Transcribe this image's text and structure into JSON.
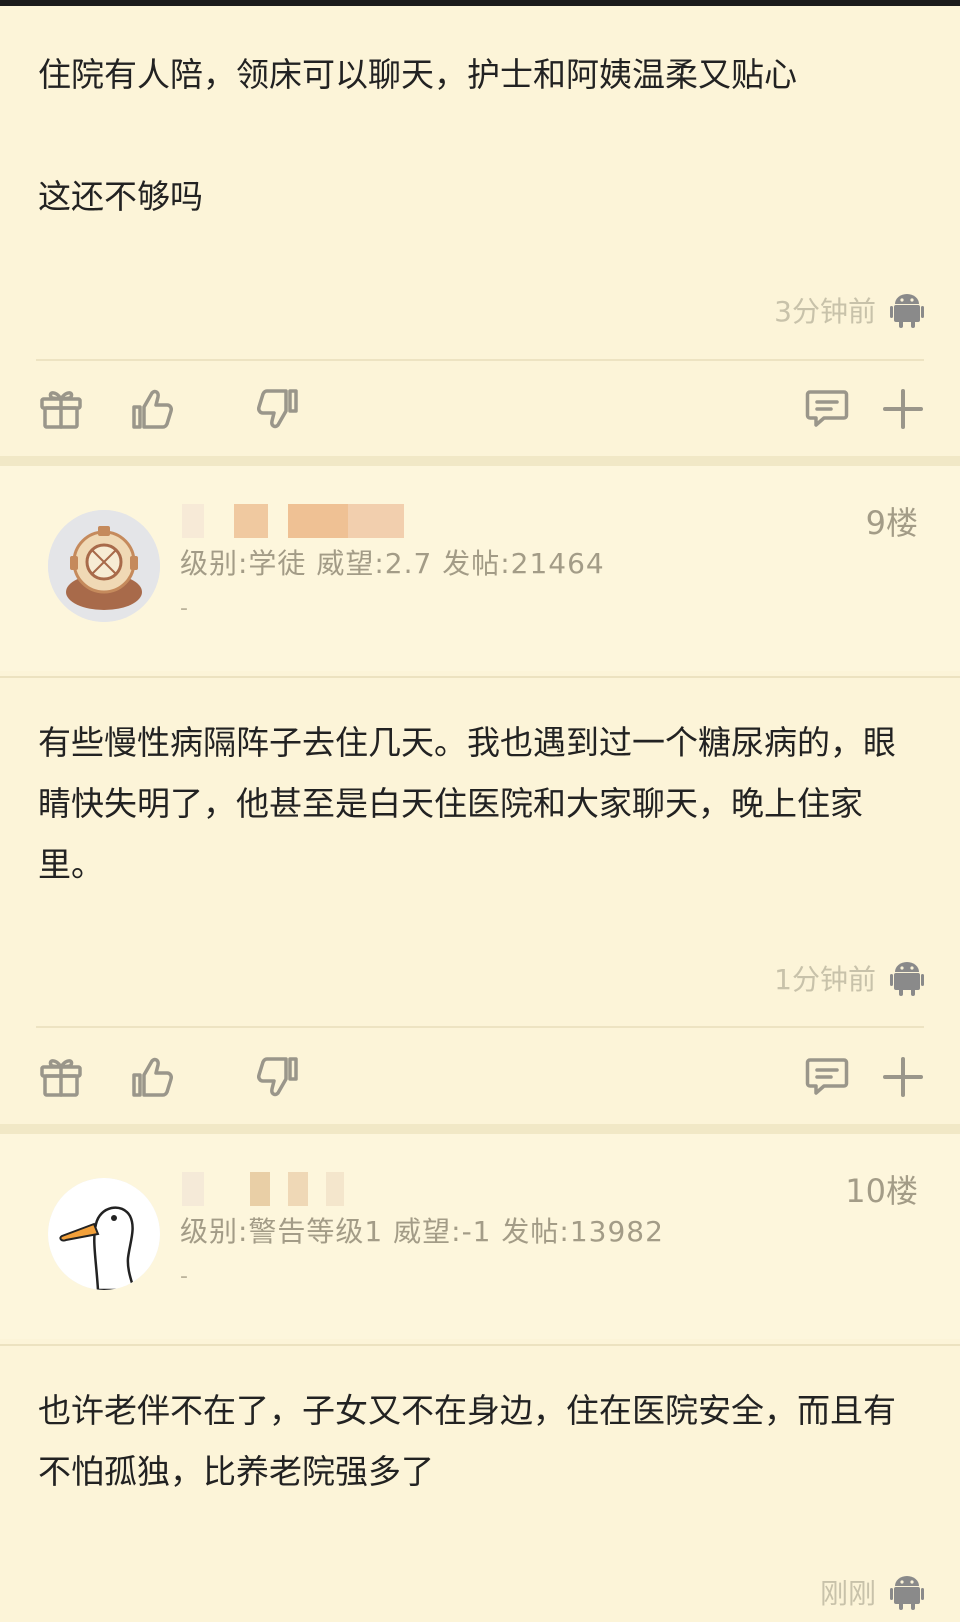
{
  "posts": [
    {
      "body": "住院有人陪，领床可以聊天，护士和阿姨温柔又贴心\n\n这还不够吗",
      "time": "3分钟前"
    },
    {
      "floor": "9楼",
      "level_line": "级别:学徒 威望:2.7 发帖:21464",
      "signature": "-",
      "body": "有些慢性病隔阵子去住几天。我也遇到过一个糖尿病的，眼睛快失明了，他甚至是白天住医院和大家聊天，晚上住家里。",
      "time": "1分钟前"
    },
    {
      "floor": "10楼",
      "level_line": "级别:警告等级1 威望:-1 发帖:13982",
      "signature": "-",
      "body": "也许老伴不在了，子女又不在身边，住在医院安全，而且有不怕孤独，比养老院强多了",
      "time": "刚刚"
    }
  ],
  "icons": {
    "gift": "gift-icon",
    "like": "thumbs-up-icon",
    "dislike": "thumbs-down-icon",
    "reply": "comment-icon",
    "more": "plus-icon",
    "device": "android-icon"
  },
  "colors": {
    "background": "#fcf4d8",
    "header_background": "#fdf6dc",
    "meta_text": "#a39c87",
    "icon": "#9a968a"
  }
}
